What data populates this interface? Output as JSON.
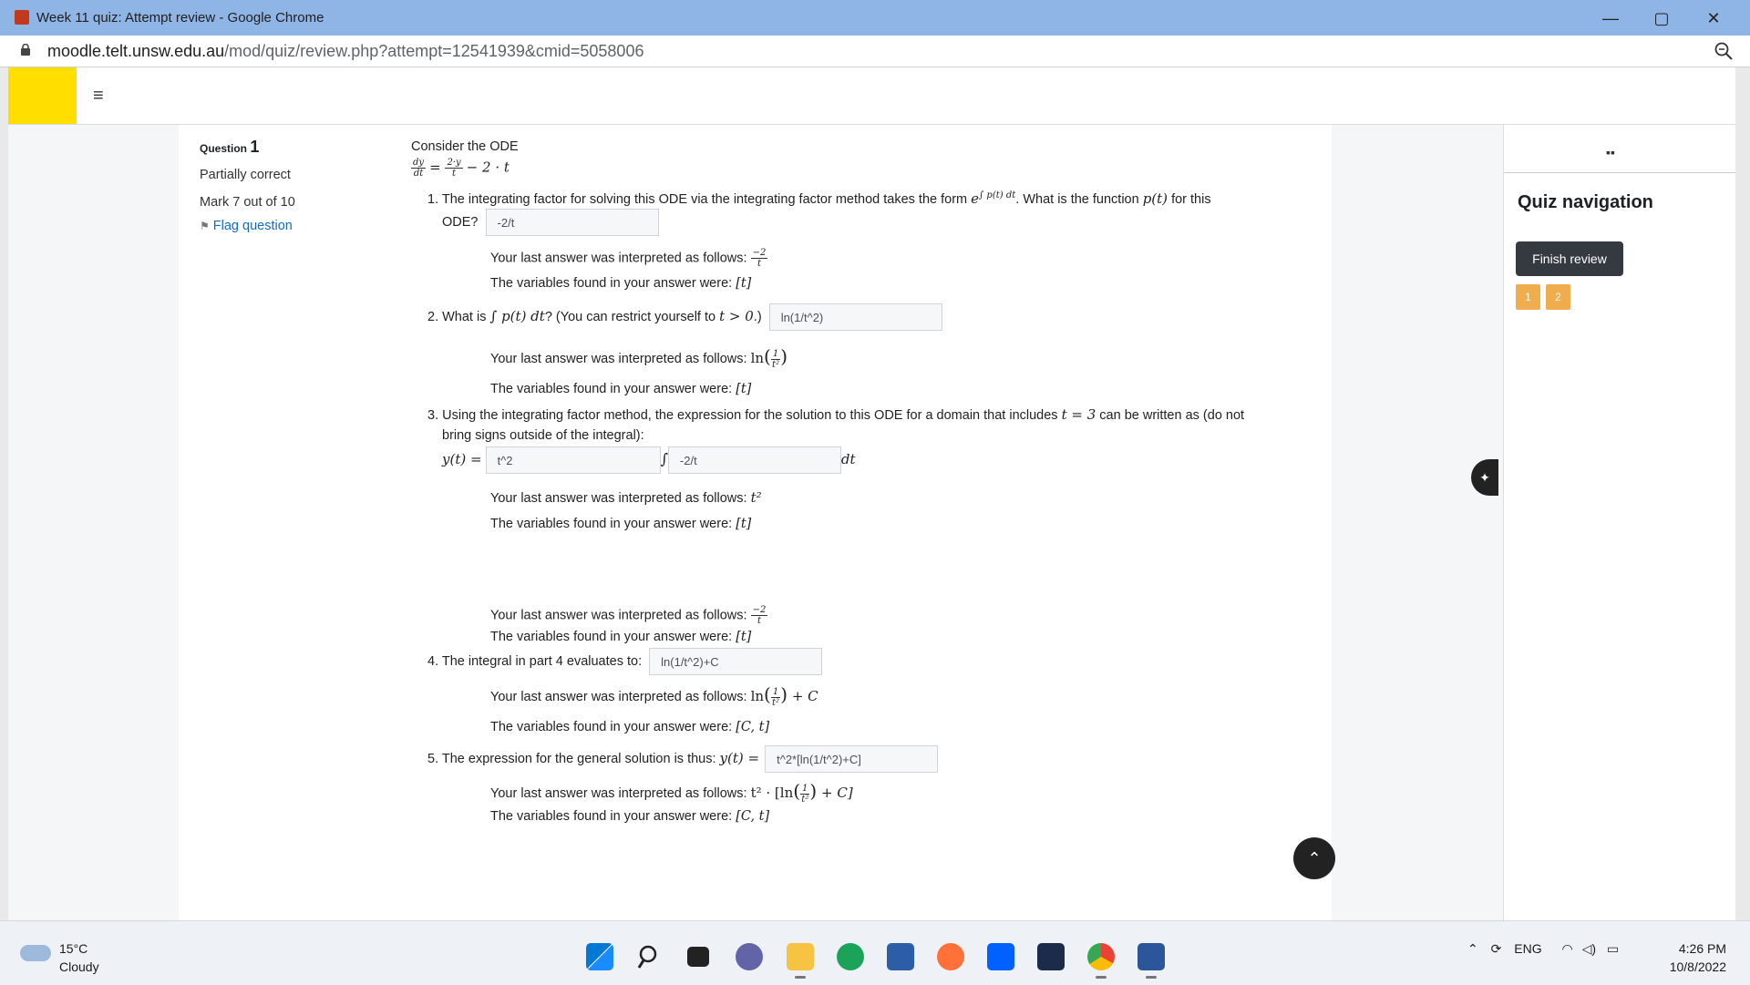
{
  "browser": {
    "window_title": "Week 11 quiz: Attempt review - Google Chrome",
    "url_domain": "moodle.telt.unsw.edu.au",
    "url_path": "/mod/quiz/review.php?attempt=12541939&cmid=5058006",
    "minimize": "—",
    "maximize": "▢",
    "close": "✕"
  },
  "navbar": {
    "menu_icon": "≡"
  },
  "question_info": {
    "label": "Question ",
    "number": "1",
    "state": "Partially correct",
    "grade": "Mark 7 out of 10",
    "flag": "Flag question"
  },
  "question": {
    "intro": "Consider the ODE",
    "ode_lhs_num": "dy",
    "ode_lhs_den": "dt",
    "ode_rhs_num": "2·y",
    "ode_rhs_den": "t",
    "ode_rhs_tail": "− 2 · t",
    "p1_text_a": "1. The integrating factor for solving this ODE via the integrating factor method takes the form ",
    "p1_if": "e",
    "p1_if_exp": "∫ p(t) dt",
    "p1_text_b": ". What is the function ",
    "p1_pt": "p(t)",
    "p1_text_c": " for this",
    "p1_text_d": "ODE?",
    "p1_answer": "-2/t",
    "p1_interp_label": "Your last answer was interpreted as follows: ",
    "p1_interp_num": "−2",
    "p1_interp_den": "t",
    "p1_vars_label": "The variables found in your answer were: ",
    "p1_vars": "[t]",
    "p2_text_a": "2. What is ",
    "p2_integral": "∫ p(t) dt",
    "p2_text_b": "? (You can restrict yourself to ",
    "p2_cond": "t > 0",
    "p2_text_c": ".)",
    "p2_answer": "ln(1/t^2)",
    "p2_interp_label": "Your last answer was interpreted as follows: ",
    "p2_interp_ln": "ln",
    "p2_interp_num": "1",
    "p2_interp_den": "t²",
    "p2_vars_label": "The variables found in your answer were: ",
    "p2_vars": "[t]",
    "p3_text_a": "3. Using the integrating factor method, the expression for the solution to this ODE for a domain that includes ",
    "p3_cond": "t = 3",
    "p3_text_b": " can be written as (do not",
    "p3_text_c": "bring signs outside of the integral):",
    "p3_lhs": "y(t) =",
    "p3_answer1": "t^2",
    "p3_integral": "∫",
    "p3_answer2": "-2/t",
    "p3_dt": "dt",
    "p3a_interp_label": "Your last answer was interpreted as follows: ",
    "p3a_interp": "t²",
    "p3a_vars_label": "The variables found in your answer were: ",
    "p3a_vars": "[t]",
    "p3b_interp_label": "Your last answer was interpreted as follows: ",
    "p3b_interp_num": "−2",
    "p3b_interp_den": "t",
    "p3b_vars_label": "The variables found in your answer were: ",
    "p3b_vars": "[t]",
    "p4_text": "4. The integral in part 4 evaluates to:",
    "p4_answer": "ln(1/t^2)+C",
    "p4_interp_label": "Your last answer was interpreted as follows: ",
    "p4_interp_ln": "ln",
    "p4_interp_num": "1",
    "p4_interp_den": "t²",
    "p4_interp_tail": " + C",
    "p4_vars_label": "The variables found in your answer were: ",
    "p4_vars": "[C, t]",
    "p5_text": "5. The expression for the general solution is thus: ",
    "p5_lhs": "y(t) =",
    "p5_answer": "t^2*[ln(1/t^2)+C]",
    "p5_interp_label": "Your last answer was interpreted as follows: ",
    "p5_interp_a": "t² · [ln",
    "p5_interp_num": "1",
    "p5_interp_den": "t²",
    "p5_interp_b": " + C]",
    "p5_vars_label": "The variables found in your answer were: ",
    "p5_vars": "[C, t]"
  },
  "drawer": {
    "grid_icon": "▪▪",
    "title": "Quiz navigation",
    "finish_button": "Finish review",
    "questions": [
      "1",
      "2"
    ]
  },
  "page_controls": {
    "pin_icon": "✦",
    "back_to_top": "⌃"
  },
  "taskbar": {
    "temperature": "15°C",
    "condition": "Cloudy",
    "language": "ENG",
    "time": "4:26 PM",
    "date": "10/8/2022"
  },
  "colors": {
    "moodle_yellow": "#ffde00",
    "quiz_nav_orange": "#f0ad4e",
    "link_blue": "#0f6cbf",
    "chrome_titlebar": "#8fb4e6"
  }
}
